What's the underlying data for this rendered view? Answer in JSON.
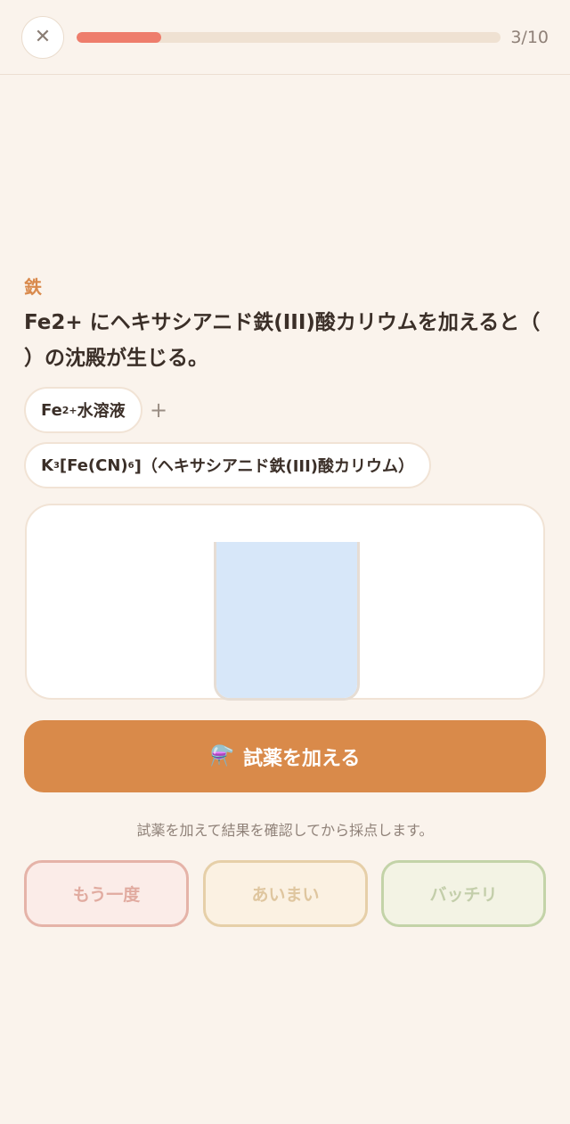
{
  "header": {
    "close_glyph": "✕",
    "progress": {
      "current": 3,
      "total": 10,
      "label": "3/10",
      "fraction": 0.2
    }
  },
  "quiz": {
    "category": "鉄",
    "question": "Fe2+ にヘキサシアニド鉄(III)酸カリウムを加えると（ ）の沈殿が生じる。"
  },
  "reagents": {
    "plus": "+",
    "chip_a": {
      "prefix": "Fe",
      "sup": "2+",
      "suffix": "水溶液"
    },
    "chip_b": {
      "k": "K",
      "k_sub": "3",
      "middle": "[Fe(CN)",
      "cn_sub": "6",
      "suffix": "]（ヘキサシアニド鉄(III)酸カリウム）"
    }
  },
  "beaker": {
    "liquid_color": "#d7e7f9",
    "fill": 1.0
  },
  "actions": {
    "add_icon": "⚗️",
    "add_label": "試薬を加える",
    "hint": "試薬を加えて結果を確認してから採点します。"
  },
  "grading": {
    "again": "もう一度",
    "vague": "あいまい",
    "good": "バッチリ"
  },
  "colors": {
    "background": "#faf3ec",
    "accent": "#d98a4a",
    "progress": "#ee7d6c",
    "category": "#d98a4d"
  }
}
